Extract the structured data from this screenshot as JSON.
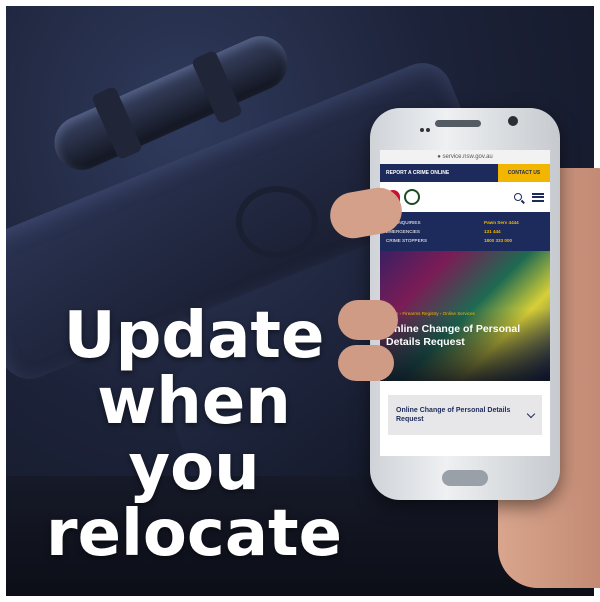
{
  "headline": {
    "line1": "Update",
    "line2": "when you",
    "line3": "relocate"
  },
  "phone": {
    "url": "● service.nsw.gov.au",
    "topbar": {
      "left_label": "REPORT A CRIME ONLINE",
      "right_label": "CONTACT US"
    },
    "contacts": [
      {
        "label": "ALL ENQUIRIES",
        "value": "Pawn Serv 4444"
      },
      {
        "label": "EMERGENCIES",
        "value": "131 444"
      },
      {
        "label": "CRIME STOPPERS",
        "value": "1800 333 000"
      }
    ],
    "breadcrumb": "Home › Firearms Registry › Online Services",
    "hero_title": "Online Change of Personal Details Request",
    "accordion_label": "Online Change of Personal Details Request"
  }
}
